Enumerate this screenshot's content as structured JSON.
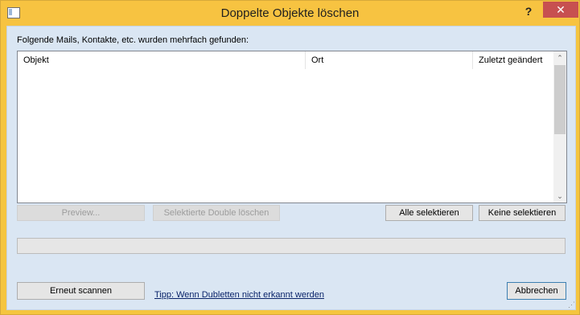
{
  "window": {
    "title": "Doppelte Objekte löschen",
    "help_glyph": "?",
    "close_glyph": "✕"
  },
  "list": {
    "caption": "Folgende Mails, Kontakte, etc. wurden mehrfach gefunden:",
    "columns": [
      "Objekt",
      "Ort",
      "Zuletzt geändert"
    ],
    "rows": [],
    "scroll_up_glyph": "⌃",
    "scroll_down_glyph": "⌄"
  },
  "buttons": {
    "preview": "Preview...",
    "delete_selected": "Selektierte Double löschen",
    "select_all": "Alle selektieren",
    "select_none": "Keine selektieren",
    "rescan": "Erneut scannen",
    "cancel": "Abbrechen"
  },
  "tip_link": "Tipp: Wenn Dubletten nicht erkannt werden",
  "progress": {
    "value": 0
  },
  "colors": {
    "title_bar": "#f7c341",
    "close_button": "#c75050",
    "client_background": "#dae6f3"
  }
}
